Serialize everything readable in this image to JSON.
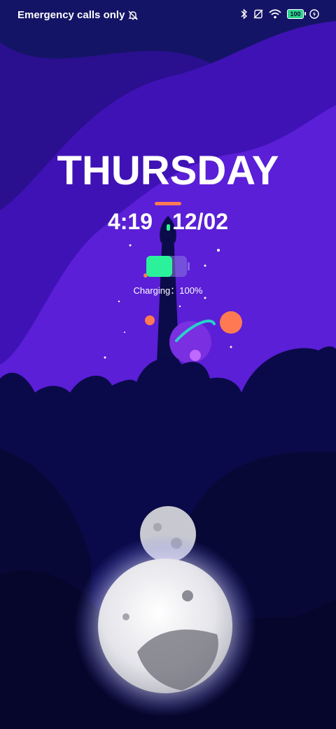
{
  "status_bar": {
    "carrier_text": "Emergency calls only",
    "icons": [
      "mute-bell-icon",
      "bluetooth-icon",
      "no-sim-icon",
      "wifi-icon",
      "battery-icon",
      "charging-bolt-icon"
    ],
    "battery_label": "100"
  },
  "lock_screen": {
    "day": "THURSDAY",
    "time": "4:19",
    "date": "12/02",
    "charging_text": "Charging：100%"
  },
  "colors": {
    "sky_top": "#141466",
    "wave_purple": "#5a1fd6",
    "accent_orange": "#ff7a52",
    "battery_green": "#2bf29a",
    "hills": "#070736"
  }
}
